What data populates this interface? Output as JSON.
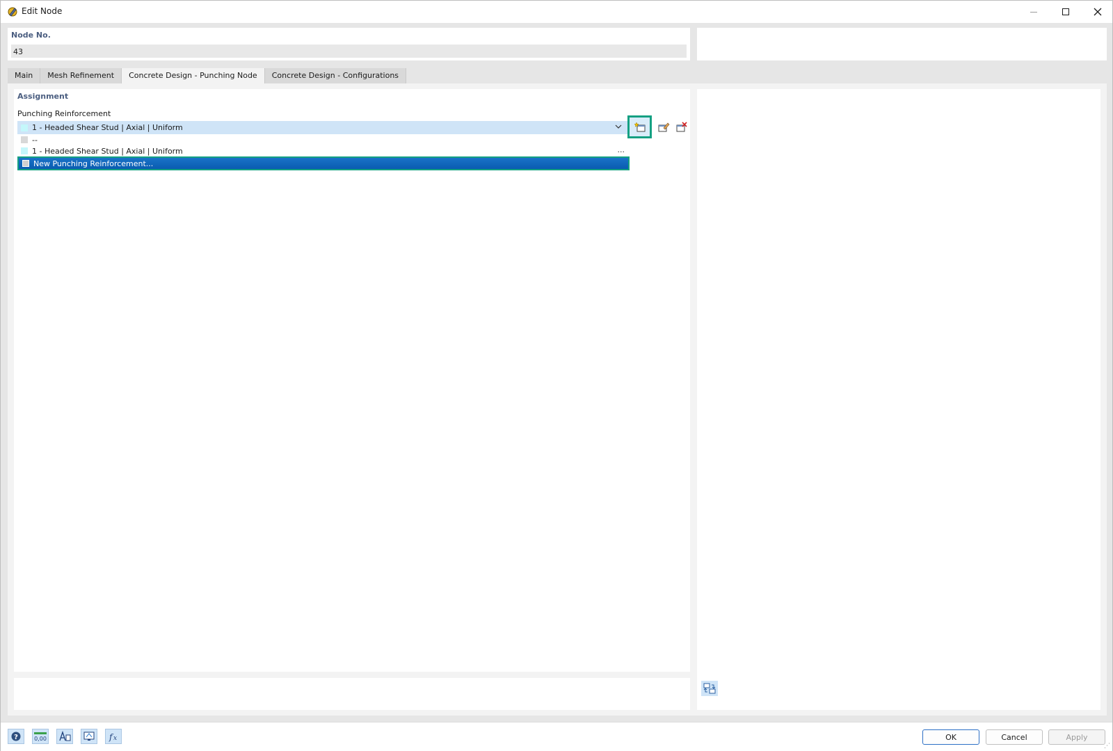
{
  "window": {
    "title": "Edit Node"
  },
  "node": {
    "label": "Node No.",
    "value": "43"
  },
  "tabs": [
    {
      "label": "Main",
      "active": false
    },
    {
      "label": "Mesh Refinement",
      "active": false
    },
    {
      "label": "Concrete Design - Punching Node",
      "active": true
    },
    {
      "label": "Concrete Design - Configurations",
      "active": false
    }
  ],
  "assignment": {
    "section_title": "Assignment",
    "field_label": "Punching Reinforcement",
    "selected": "1 - Headed Shear Stud | Axial | Uniform",
    "options": [
      {
        "label": "--"
      },
      {
        "label": "1 - Headed Shear Stud | Axial | Uniform",
        "more": "..."
      },
      {
        "label": "New Punching Reinforcement...",
        "highlighted": true
      }
    ]
  },
  "footer": {
    "ok": "OK",
    "cancel": "Cancel",
    "apply": "Apply"
  },
  "colors": {
    "accent_highlight": "#14a082",
    "selection_blue": "#0a5cb0",
    "combo_bg": "#cfe4f7",
    "section_title": "#4b5e80"
  },
  "icons": {
    "app": "node-edit-icon",
    "new": "new-item-icon",
    "edit": "edit-item-icon",
    "delete": "delete-item-icon",
    "swap": "swap-view-icon",
    "help": "help-icon",
    "units": "units-icon",
    "display": "display-properties-icon",
    "view": "view-icon",
    "formula": "formula-icon"
  }
}
